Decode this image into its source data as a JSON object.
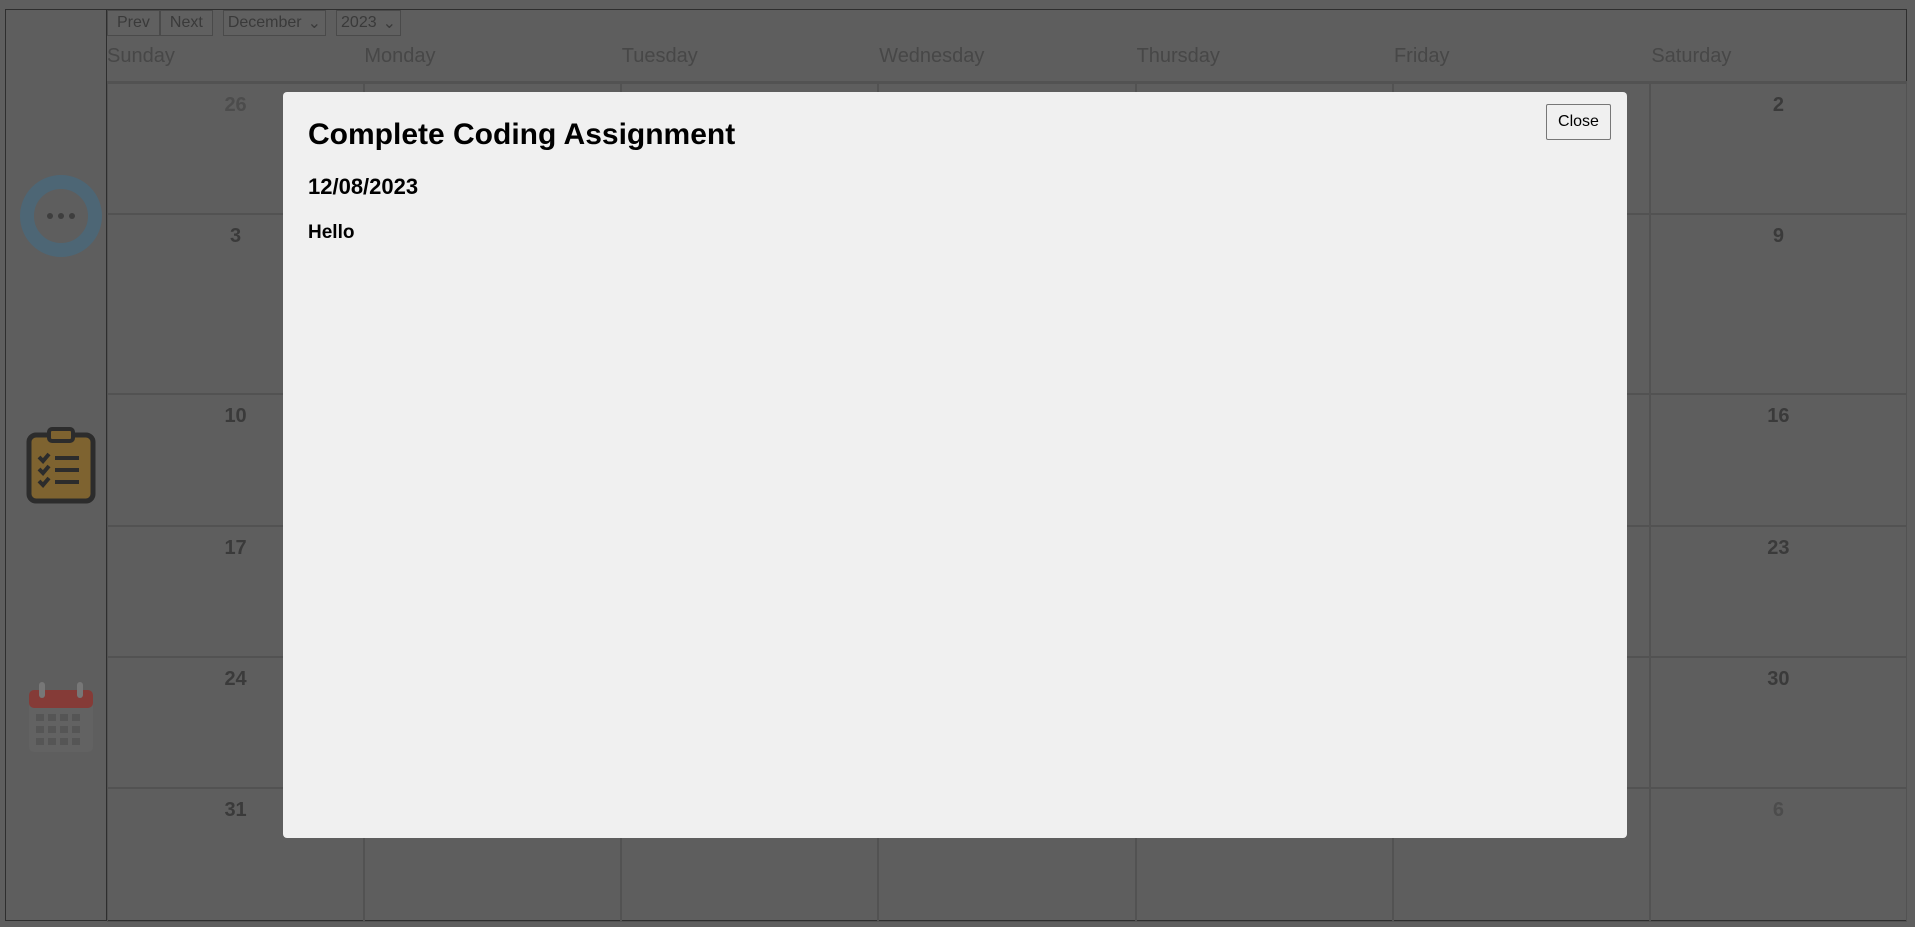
{
  "controls": {
    "prev_label": "Prev",
    "next_label": "Next",
    "month": "December",
    "year": "2023"
  },
  "weekdays": [
    "Sunday",
    "Monday",
    "Tuesday",
    "Wednesday",
    "Thursday",
    "Friday",
    "Saturday"
  ],
  "visible_dates": {
    "sunday": [
      "26",
      "3",
      "10",
      "17",
      "24",
      "31"
    ],
    "saturday": [
      "2",
      "9",
      "16",
      "23",
      "30",
      "6"
    ]
  },
  "sidebar": {
    "icons": [
      "chat-bubble-icon",
      "clipboard-checklist-icon",
      "calendar-icon"
    ]
  },
  "modal": {
    "title": "Complete Coding Assignment",
    "date": "12/08/2023",
    "description": "Hello",
    "close_label": "Close"
  }
}
